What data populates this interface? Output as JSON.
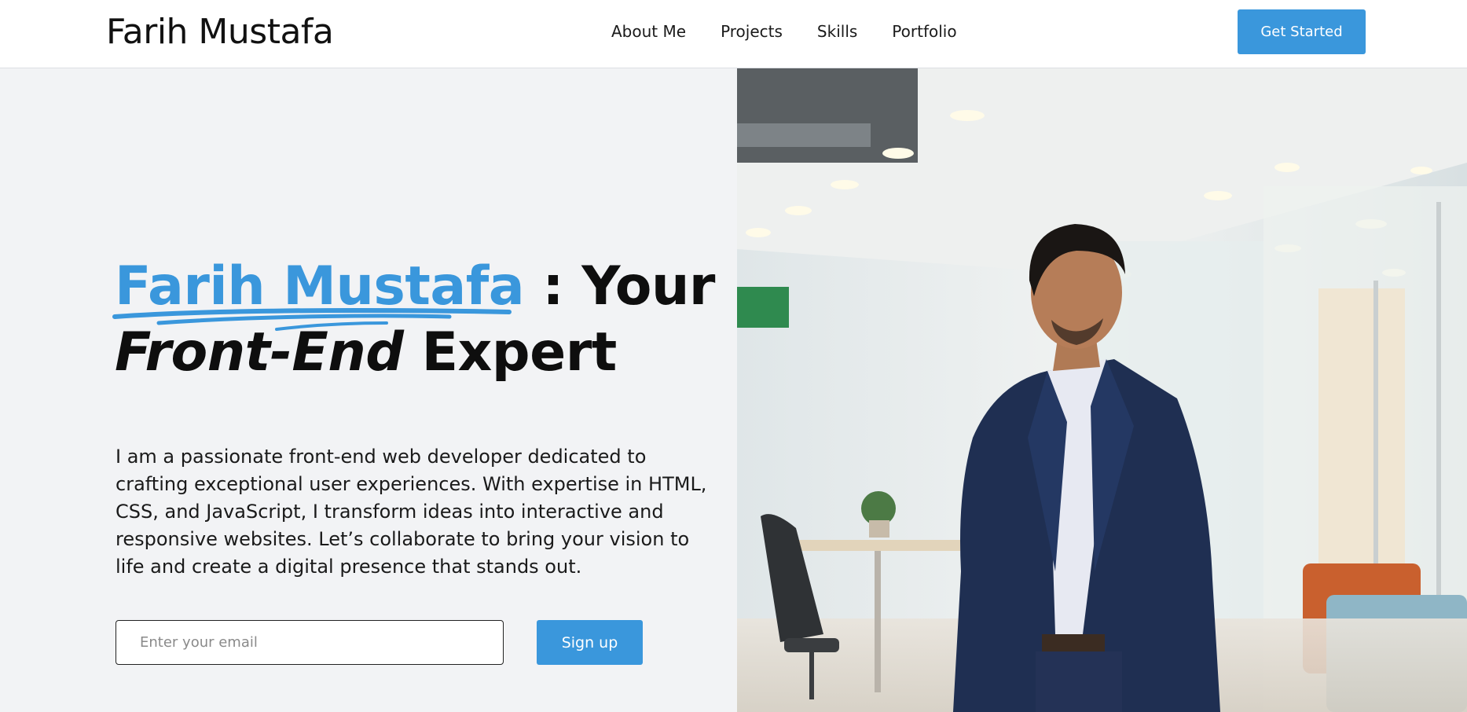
{
  "header": {
    "logo": "Farih Mustafa",
    "nav": [
      "About Me",
      "Projects",
      "Skills",
      "Portfolio"
    ],
    "cta_label": "Get Started"
  },
  "hero": {
    "headline_name": "Farih Mustafa",
    "headline_rest": " : Your",
    "headline_em": "Front-End",
    "headline_end": " Expert",
    "description": "I am a passionate front-end web developer dedicated to crafting exceptional user experiences. With expertise in HTML, CSS, and JavaScript, I transform ideas into interactive and responsive websites. Let’s collaborate to bring your vision to life and create a digital presence that stands out.",
    "email_placeholder": "Enter your email",
    "signup_label": "Sign up"
  },
  "colors": {
    "accent": "#3a97dc",
    "hero_bg": "#f2f3f5"
  }
}
